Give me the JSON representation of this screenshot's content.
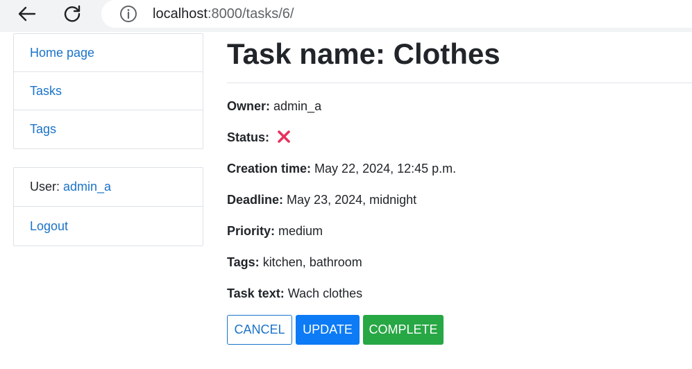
{
  "browser": {
    "url_host": "localhost",
    "url_path": ":8000/tasks/6/"
  },
  "sidebar": {
    "nav": [
      {
        "label": "Home page"
      },
      {
        "label": "Tasks"
      },
      {
        "label": "Tags"
      }
    ],
    "user_label": "User: ",
    "user_name": "admin_a",
    "logout_label": "Logout"
  },
  "task": {
    "title": "Task name: Clothes",
    "owner_label": "Owner:",
    "owner": "admin_a",
    "status_label": "Status:",
    "status_icon": "cross-mark-icon",
    "status_color": "#e8315b",
    "creation_label": "Creation time:",
    "creation_time": "May 22, 2024, 12:45 p.m.",
    "deadline_label": "Deadline:",
    "deadline": "May 23, 2024, midnight",
    "priority_label": "Priority:",
    "priority": "medium",
    "tags_label": "Tags:",
    "tags": "kitchen, bathroom",
    "text_label": "Task text:",
    "text": "Wach clothes"
  },
  "actions": {
    "cancel_label": "CANCEL",
    "update_label": "UPDATE",
    "complete_label": "COMPLETE"
  },
  "colors": {
    "link": "#1a73c9",
    "update": "#0d7bf5",
    "complete": "#28a745"
  }
}
